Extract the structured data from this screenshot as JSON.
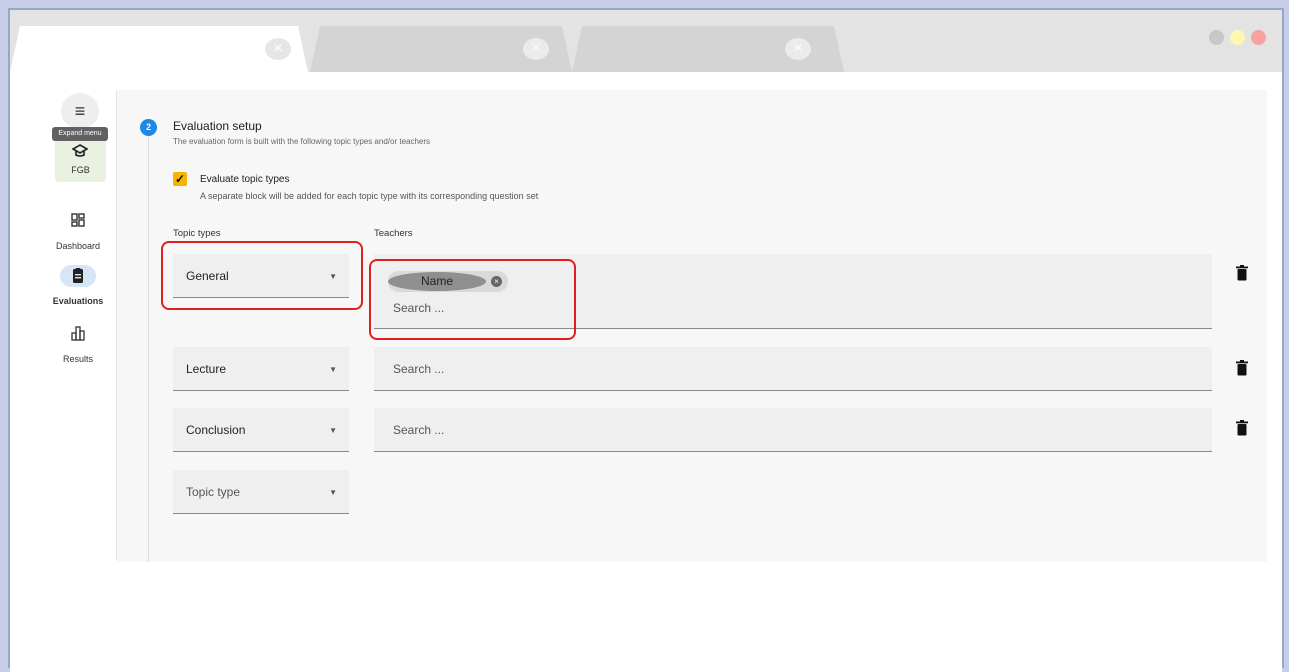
{
  "browser": {
    "tabs": [
      {
        "close": "×"
      },
      {
        "close": "×"
      },
      {
        "close": "×"
      }
    ],
    "window_dots": [
      "#c7c7c7",
      "#fff6b0",
      "#f7a1a1"
    ]
  },
  "sidebar": {
    "menu_icon": "≡",
    "tooltip": "Expand menu",
    "org": {
      "label": "FGB",
      "icon": "graduation-cap-icon"
    },
    "items": [
      {
        "label": "Dashboard",
        "icon": "dashboard-icon"
      },
      {
        "label": "Evaluations",
        "icon": "clipboard-icon",
        "selected": true
      },
      {
        "label": "Results",
        "icon": "bar-chart-icon"
      }
    ]
  },
  "step": {
    "number": "2",
    "title": "Evaluation setup",
    "subtitle": "The evaluation form is built with the following topic types and/or teachers",
    "checkbox": {
      "checked": true,
      "label": "Evaluate topic types",
      "description": "A separate block will be added for each topic type with its corresponding question set"
    },
    "columns": {
      "topic_types": "Topic types",
      "teachers": "Teachers"
    },
    "rows": [
      {
        "topic": "General",
        "chip": "Name",
        "search_placeholder": "Search ..."
      },
      {
        "topic": "Lecture",
        "search_placeholder": "Search ..."
      },
      {
        "topic": "Conclusion",
        "search_placeholder": "Search ..."
      }
    ],
    "empty_select_placeholder": "Topic type"
  },
  "colors": {
    "accent": "#1e88e5",
    "checkbox": "#f4b400",
    "highlight": "#e01f1f"
  }
}
